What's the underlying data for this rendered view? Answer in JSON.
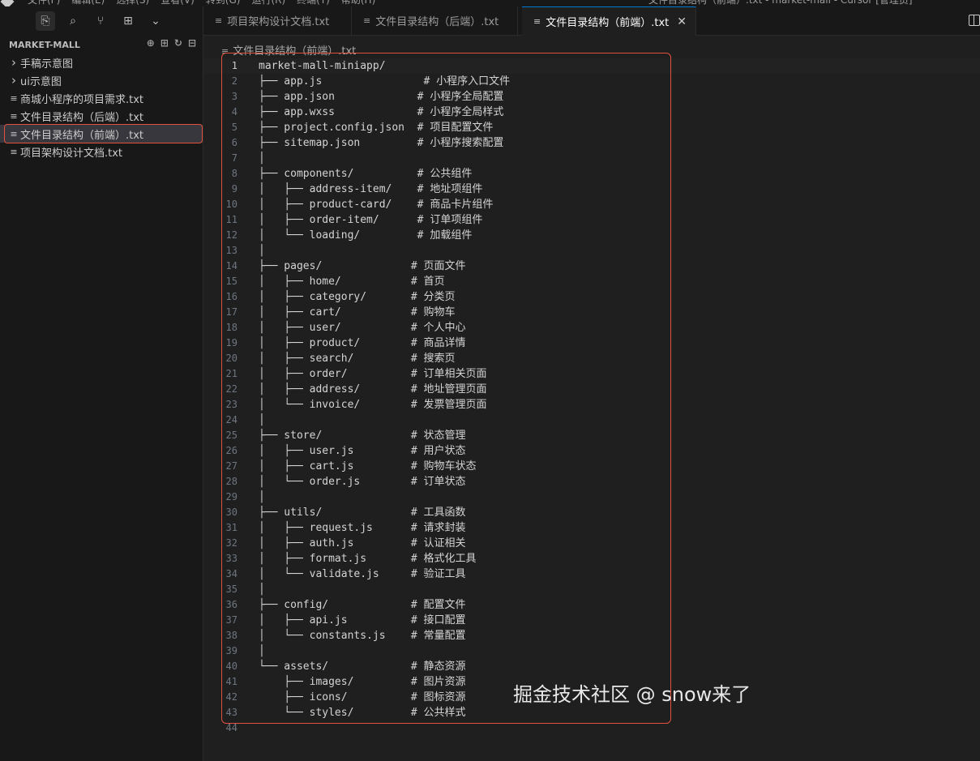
{
  "menubar": {
    "items": [
      "文件(F)",
      "编辑(E)",
      "选择(S)",
      "查看(V)",
      "转到(G)",
      "运行(R)",
      "终端(T)",
      "帮助(H)"
    ],
    "window_title": "文件目录结构（前端）.txt - market-mall - Cursor [管理员]"
  },
  "activity": {
    "icons": [
      "files-icon",
      "search-icon",
      "source-control-icon",
      "extensions-icon",
      "chevron-down-icon"
    ]
  },
  "explorer": {
    "title": "MARKET-MALL",
    "items": [
      {
        "label": "手稿示意图",
        "type": "folder"
      },
      {
        "label": "ui示意图",
        "type": "folder"
      },
      {
        "label": "商城小程序的项目需求.txt",
        "type": "file"
      },
      {
        "label": "文件目录结构（后端）.txt",
        "type": "file"
      },
      {
        "label": "文件目录结构（前端）.txt",
        "type": "file",
        "selected": true
      },
      {
        "label": "项目架构设计文档.txt",
        "type": "file"
      }
    ]
  },
  "tabs": [
    {
      "label": "项目架构设计文档.txt",
      "active": false
    },
    {
      "label": "文件目录结构（后端）.txt",
      "active": false
    },
    {
      "label": "文件目录结构（前端）.txt",
      "active": true
    }
  ],
  "breadcrumb": "文件目录结构（前端）.txt",
  "code_lines": [
    "market-mall-miniapp/",
    "├── app.js                # 小程序入口文件",
    "├── app.json             # 小程序全局配置",
    "├── app.wxss             # 小程序全局样式",
    "├── project.config.json  # 项目配置文件",
    "├── sitemap.json         # 小程序搜索配置",
    "│",
    "├── components/          # 公共组件",
    "│   ├── address-item/    # 地址项组件",
    "│   ├── product-card/    # 商品卡片组件",
    "│   ├── order-item/      # 订单项组件",
    "│   └── loading/         # 加载组件",
    "│",
    "├── pages/              # 页面文件",
    "│   ├── home/           # 首页",
    "│   ├── category/       # 分类页",
    "│   ├── cart/           # 购物车",
    "│   ├── user/           # 个人中心",
    "│   ├── product/        # 商品详情",
    "│   ├── search/         # 搜索页",
    "│   ├── order/          # 订单相关页面",
    "│   ├── address/        # 地址管理页面",
    "│   └── invoice/        # 发票管理页面",
    "│",
    "├── store/              # 状态管理",
    "│   ├── user.js         # 用户状态",
    "│   ├── cart.js         # 购物车状态",
    "│   └── order.js        # 订单状态",
    "│",
    "├── utils/              # 工具函数",
    "│   ├── request.js      # 请求封装",
    "│   ├── auth.js         # 认证相关",
    "│   ├── format.js       # 格式化工具",
    "│   └── validate.js     # 验证工具",
    "│",
    "├── config/             # 配置文件",
    "│   ├── api.js          # 接口配置",
    "│   └── constants.js    # 常量配置",
    "│",
    "└── assets/             # 静态资源",
    "    ├── images/         # 图片资源",
    "    ├── icons/          # 图标资源",
    "    └── styles/         # 公共样式",
    ""
  ],
  "watermark": "掘金技术社区 @ snow来了"
}
